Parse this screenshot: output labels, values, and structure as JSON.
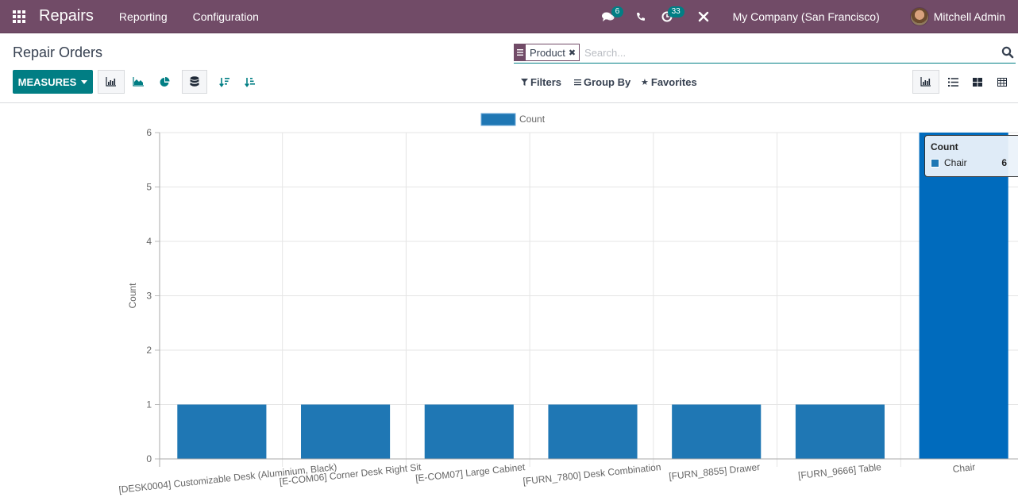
{
  "navbar": {
    "app_name": "Repairs",
    "menus": [
      "Reporting",
      "Configuration"
    ],
    "messages_badge": "6",
    "activities_badge": "33",
    "company": "My Company (San Francisco)",
    "user": "Mitchell Admin",
    "brand_color": "#714B67"
  },
  "control_panel": {
    "title": "Repair Orders",
    "measures_label": "MEASURES",
    "search": {
      "facet_label": "Product",
      "placeholder": "Search..."
    },
    "filters_label": "Filters",
    "group_by_label": "Group By",
    "favorites_label": "Favorites",
    "chart_type_buttons": [
      "bar-chart",
      "line-chart",
      "pie-chart"
    ],
    "active_chart_type": "bar-chart",
    "stacked_active": true,
    "views": [
      "graph",
      "list",
      "kanban",
      "pivot"
    ],
    "active_view": "graph",
    "accent_color": "#017e84"
  },
  "chart_data": {
    "type": "bar",
    "title": "",
    "xlabel": "",
    "ylabel": "Count",
    "ylim": [
      0,
      6
    ],
    "yticks": [
      0,
      1,
      2,
      3,
      4,
      5,
      6
    ],
    "grid": true,
    "legend": {
      "position": "top",
      "entries": [
        "Count"
      ]
    },
    "categories": [
      "[DESK0004] Customizable Desk (Aluminium, Black)",
      "[E-COM06] Corner Desk Right Sit",
      "[E-COM07] Large Cabinet",
      "[FURN_7800] Desk Combination",
      "[FURN_8855] Drawer",
      "[FURN_9666] Table",
      "Chair"
    ],
    "series": [
      {
        "name": "Count",
        "color": "#1f77b4",
        "values": [
          1,
          1,
          1,
          1,
          1,
          1,
          6
        ]
      }
    ],
    "highlighted_index": 6,
    "highlight_color": "#006bbd",
    "tooltip": {
      "title": "Count",
      "label": "Chair",
      "value": "6"
    }
  }
}
